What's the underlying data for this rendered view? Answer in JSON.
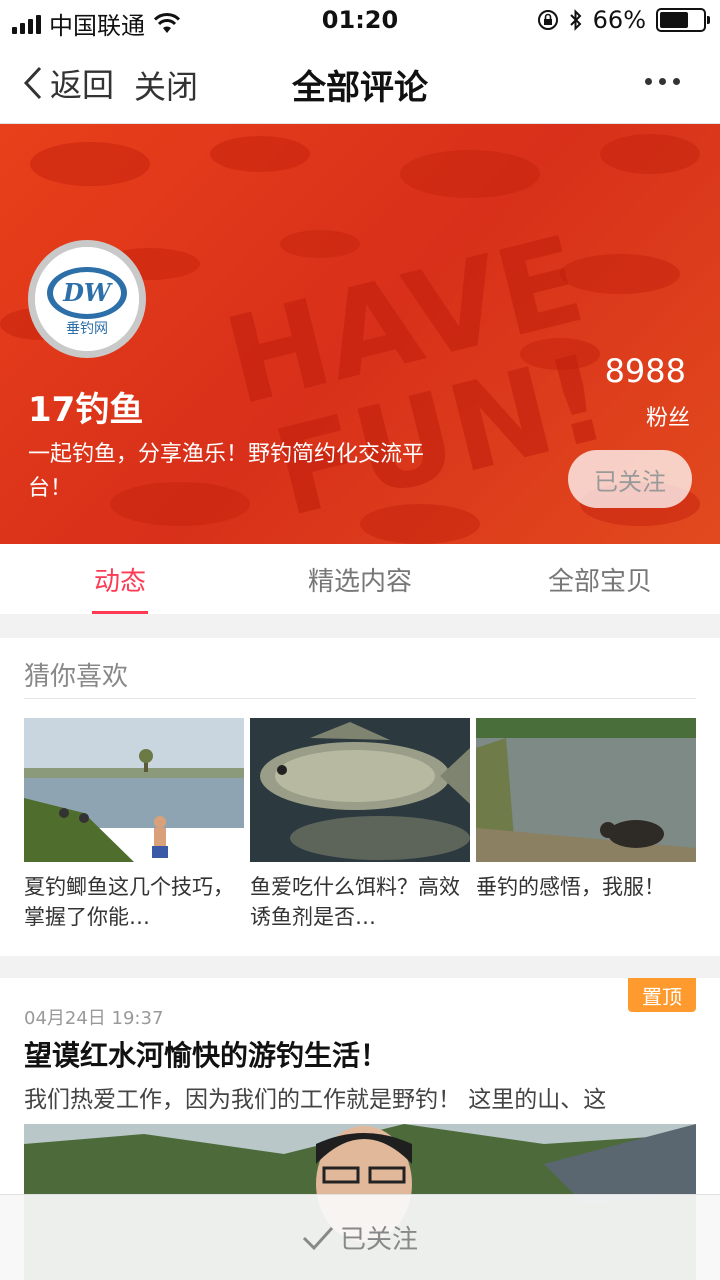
{
  "status_bar": {
    "carrier": "中国联通",
    "time": "01:20",
    "battery": "66%",
    "battery_level": 0.66
  },
  "nav": {
    "back_label": "返回",
    "close_label": "关闭",
    "title": "全部评论"
  },
  "shop": {
    "logo_text": "DW",
    "logo_sub": "垂钓网",
    "name": "17钓鱼",
    "description": "一起钓鱼，分享渔乐！野钓简约化交流平台！",
    "fans_count": "8988",
    "fans_label": "粉丝",
    "follow_button": "已关注",
    "banner_color": "#e23e1c"
  },
  "tabs": [
    {
      "label": "动态",
      "active": true
    },
    {
      "label": "精选内容",
      "active": false
    },
    {
      "label": "全部宝贝",
      "active": false
    }
  ],
  "guess": {
    "title": "猜你喜欢",
    "items": [
      {
        "text": "夏钓鲫鱼这几个技巧，掌握了你能…"
      },
      {
        "text": "鱼爱吃什么饵料？高效诱鱼剂是否…"
      },
      {
        "text": "垂钓的感悟，我服！"
      }
    ]
  },
  "post": {
    "badge": "置顶",
    "date": "04月24日 19:37",
    "title": "望谟红水河愉快的游钓生活！",
    "excerpt": "我们热爱工作，因为我们的工作就是野钓！ 这里的山、这"
  },
  "bottom_bar": {
    "label": "已关注"
  },
  "colors": {
    "accent": "#ff3a55",
    "pin": "#ff9a2e"
  }
}
